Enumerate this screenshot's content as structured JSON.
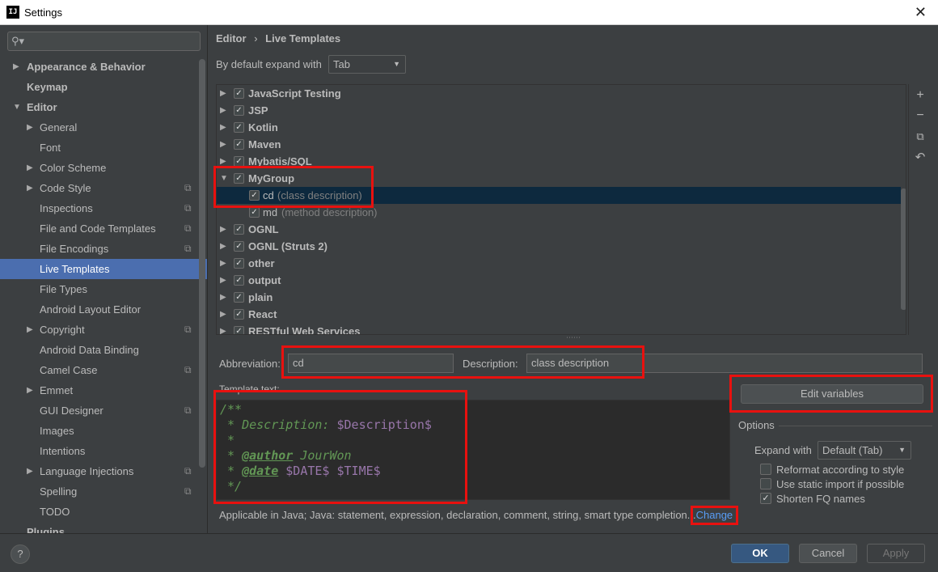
{
  "window": {
    "title": "Settings",
    "app_icon": "IJ"
  },
  "search": {
    "placeholder": ""
  },
  "sidebar": {
    "items": [
      {
        "label": "Appearance & Behavior"
      },
      {
        "label": "Keymap"
      },
      {
        "label": "Editor"
      },
      {
        "label": "General"
      },
      {
        "label": "Font"
      },
      {
        "label": "Color Scheme"
      },
      {
        "label": "Code Style"
      },
      {
        "label": "Inspections"
      },
      {
        "label": "File and Code Templates"
      },
      {
        "label": "File Encodings"
      },
      {
        "label": "Live Templates"
      },
      {
        "label": "File Types"
      },
      {
        "label": "Android Layout Editor"
      },
      {
        "label": "Copyright"
      },
      {
        "label": "Android Data Binding"
      },
      {
        "label": "Camel Case"
      },
      {
        "label": "Emmet"
      },
      {
        "label": "GUI Designer"
      },
      {
        "label": "Images"
      },
      {
        "label": "Intentions"
      },
      {
        "label": "Language Injections"
      },
      {
        "label": "Spelling"
      },
      {
        "label": "TODO"
      },
      {
        "label": "Plugins"
      }
    ]
  },
  "breadcrumb": {
    "parent": "Editor",
    "separator": "›",
    "current": "Live Templates"
  },
  "expand": {
    "label": "By default expand with",
    "value": "Tab"
  },
  "tree": {
    "rows": [
      {
        "label": "JavaScript Testing",
        "desc": ""
      },
      {
        "label": "JSP",
        "desc": ""
      },
      {
        "label": "Kotlin",
        "desc": ""
      },
      {
        "label": "Maven",
        "desc": ""
      },
      {
        "label": "Mybatis/SQL",
        "desc": ""
      },
      {
        "label": "MyGroup",
        "desc": ""
      },
      {
        "label": "cd",
        "desc": "(class description)"
      },
      {
        "label": "md",
        "desc": "(method description)"
      },
      {
        "label": "OGNL",
        "desc": ""
      },
      {
        "label": "OGNL (Struts 2)",
        "desc": ""
      },
      {
        "label": "other",
        "desc": ""
      },
      {
        "label": "output",
        "desc": ""
      },
      {
        "label": "plain",
        "desc": ""
      },
      {
        "label": "React",
        "desc": ""
      },
      {
        "label": "RESTful Web Services",
        "desc": ""
      }
    ]
  },
  "tools": {
    "add": "+",
    "remove": "−",
    "copy": "⧉",
    "restore": "↶"
  },
  "abbreviation": {
    "label": "Abbreviation:",
    "value": "cd"
  },
  "description": {
    "label": "Description:",
    "value": "class description"
  },
  "template": {
    "label": "Template text:",
    "lines": {
      "l1": "/**",
      "l2_prefix": " * Description: ",
      "l2_var": "$Description$",
      "l3": " *",
      "l4_prefix": " * ",
      "l4_tag": "@author",
      "l4_value": " JourWon",
      "l5_prefix": " * ",
      "l5_tag": "@date",
      "l5_var": " $DATE$ $TIME$",
      "l6": " */"
    }
  },
  "edit_variables": "Edit variables",
  "options": {
    "title": "Options",
    "expand_with_label": "Expand with",
    "expand_with_value": "Default (Tab)",
    "reformat": "Reformat according to style",
    "static_import": "Use static import if possible",
    "shorten": "Shorten FQ names"
  },
  "applicable": {
    "text": "Applicable in Java; Java: statement, expression, declaration, comment, string, smart type completion...",
    "link": "Change"
  },
  "buttons": {
    "help": "?",
    "ok": "OK",
    "cancel": "Cancel",
    "apply": "Apply"
  },
  "colors": {
    "selection": "#4b6eaf",
    "highlight": "#e8110f",
    "link": "#589df6"
  }
}
